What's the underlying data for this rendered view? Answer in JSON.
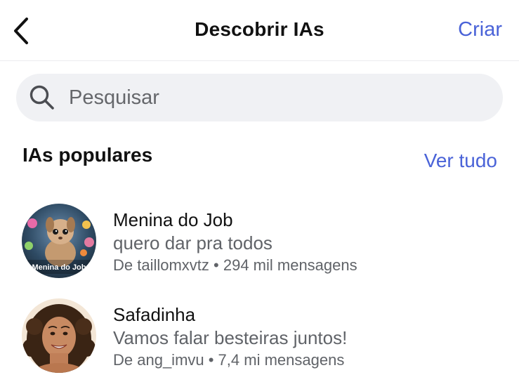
{
  "header": {
    "title": "Descobrir IAs",
    "create_label": "Criar",
    "back_icon": "chevron-left-icon"
  },
  "search": {
    "placeholder": "Pesquisar",
    "value": "",
    "icon": "search-icon"
  },
  "popular": {
    "title": "IAs populares",
    "see_all_label": "Ver tudo",
    "items": [
      {
        "name": "Menina do Job",
        "description": "quero dar pra todos",
        "meta": "De taillomxvtz • 294 mil mensagens",
        "avatar_caption": "Menina do Job"
      },
      {
        "name": "Safadinha",
        "description": "Vamos falar besteiras juntos!",
        "meta": "De ang_imvu • 7,4 mi mensagens"
      }
    ]
  },
  "colors": {
    "accent": "#4a63d8",
    "search_bg": "#f0f1f4",
    "secondary_text": "#606368"
  }
}
